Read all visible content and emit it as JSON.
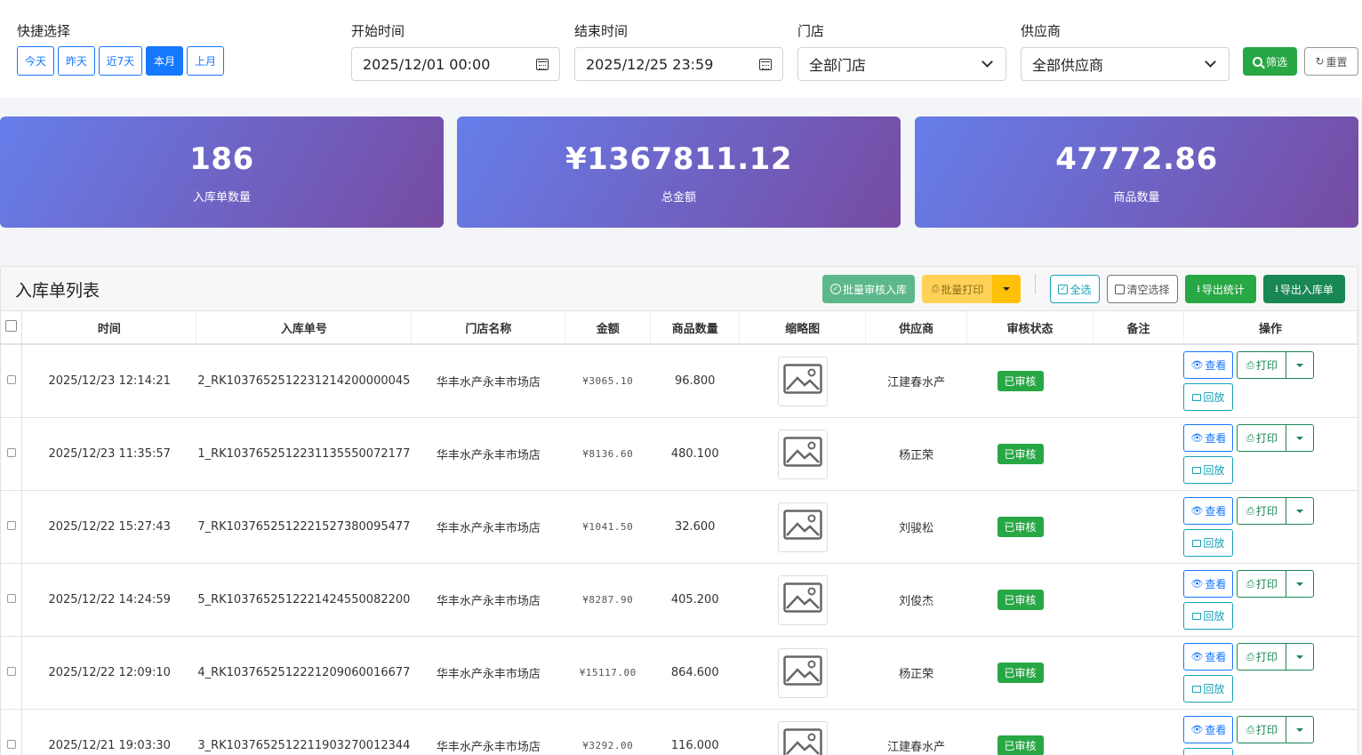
{
  "filters": {
    "quick_label": "快捷选择",
    "quick_buttons": [
      {
        "label": "今天",
        "active": false
      },
      {
        "label": "昨天",
        "active": false
      },
      {
        "label": "近7天",
        "active": false
      },
      {
        "label": "本月",
        "active": true
      },
      {
        "label": "上月",
        "active": false
      }
    ],
    "start_label": "开始时间",
    "start_value": "2025/12/01 00:00",
    "end_label": "结束时间",
    "end_value": "2025/12/25 23:59",
    "store_label": "门店",
    "store_value": "全部门店",
    "supplier_label": "供应商",
    "supplier_value": "全部供应商",
    "filter_button": "筛选",
    "reset_button": "重置"
  },
  "stats": [
    {
      "value": "186",
      "label": "入库单数量"
    },
    {
      "value": "¥1367811.12",
      "label": "总金额"
    },
    {
      "value": "47772.86",
      "label": "商品数量"
    }
  ],
  "list": {
    "title": "入库单列表",
    "toolbar": {
      "batch_audit": "批量审核入库",
      "batch_print": "批量打印",
      "select_all": "全选",
      "clear_select": "清空选择",
      "export_stats": "导出统计",
      "export_orders": "导出入库单"
    },
    "columns": [
      "时间",
      "入库单号",
      "门店名称",
      "金额",
      "商品数量",
      "缩略图",
      "供应商",
      "审核状态",
      "备注",
      "操作"
    ],
    "row_actions": {
      "view": "查看",
      "print": "打印",
      "replay": "回放"
    },
    "rows": [
      {
        "time": "2025/12/23 12:14:21",
        "order_no": "2_RK1037652512231214200000045",
        "store": "华丰水产永丰市场店",
        "amount": "¥3065.10",
        "qty": "96.800",
        "supplier": "江建春水产",
        "status": "已审核",
        "remark": ""
      },
      {
        "time": "2025/12/23 11:35:57",
        "order_no": "1_RK1037652512231135550072177",
        "store": "华丰水产永丰市场店",
        "amount": "¥8136.60",
        "qty": "480.100",
        "supplier": "杨正荣",
        "status": "已审核",
        "remark": ""
      },
      {
        "time": "2025/12/22 15:27:43",
        "order_no": "7_RK1037652512221527380095477",
        "store": "华丰水产永丰市场店",
        "amount": "¥1041.50",
        "qty": "32.600",
        "supplier": "刘骏松",
        "status": "已审核",
        "remark": ""
      },
      {
        "time": "2025/12/22 14:24:59",
        "order_no": "5_RK1037652512221424550082200",
        "store": "华丰水产永丰市场店",
        "amount": "¥8287.90",
        "qty": "405.200",
        "supplier": "刘俊杰",
        "status": "已审核",
        "remark": ""
      },
      {
        "time": "2025/12/22 12:09:10",
        "order_no": "4_RK1037652512221209060016677",
        "store": "华丰水产永丰市场店",
        "amount": "¥15117.00",
        "qty": "864.600",
        "supplier": "杨正荣",
        "status": "已审核",
        "remark": ""
      },
      {
        "time": "2025/12/21 19:03:30",
        "order_no": "3_RK1037652512211903270012344",
        "store": "华丰水产永丰市场店",
        "amount": "¥3292.00",
        "qty": "116.000",
        "supplier": "江建春水产",
        "status": "已审核",
        "remark": ""
      }
    ]
  },
  "colors": {
    "primary": "#1677ff",
    "success": "#28a745",
    "dark_success": "#198754",
    "warning": "#ffc107",
    "info": "#17a2b8",
    "card_gradient_start": "#667eea",
    "card_gradient_end": "#764ba2"
  },
  "icons": {
    "calendar": "calendar-icon",
    "dropdown": "chevron-down-icon",
    "search": "search-icon",
    "reset": "refresh-icon",
    "image_placeholder": "image-placeholder-icon",
    "view": "eye-icon",
    "print": "printer-icon",
    "replay": "video-icon",
    "export": "download-icon",
    "check": "check-circle-icon",
    "checkbox": "checkbox-icon"
  }
}
